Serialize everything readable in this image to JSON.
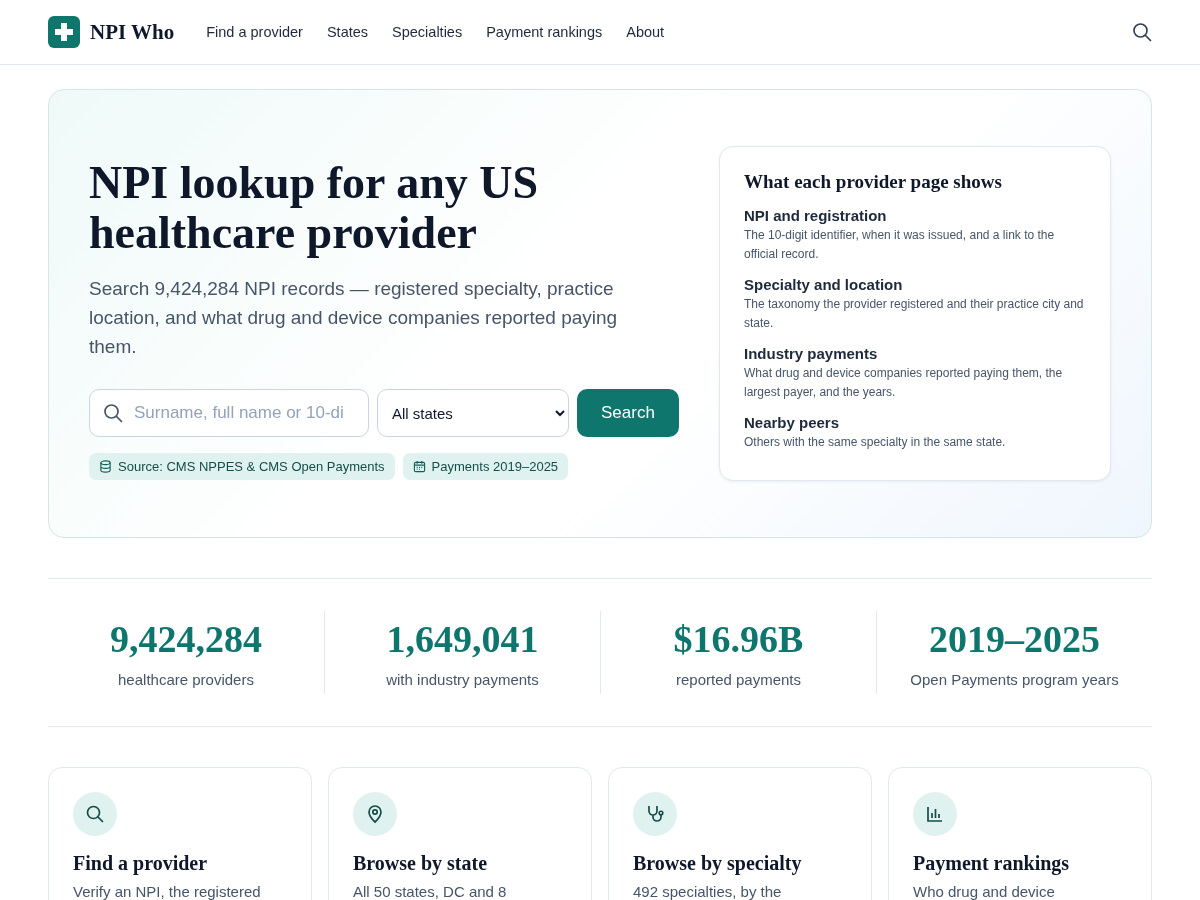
{
  "header": {
    "logo": "NPI Who",
    "nav": [
      {
        "label": "Find a provider"
      },
      {
        "label": "States"
      },
      {
        "label": "Specialties"
      },
      {
        "label": "Payment rankings"
      },
      {
        "label": "About"
      }
    ]
  },
  "hero": {
    "title": "NPI lookup for any US healthcare provider",
    "subtitle": "Search 9,424,284 NPI records — registered specialty, practice location, and what drug and device companies reported paying them.",
    "search": {
      "placeholder": "Surname, full name or 10-di",
      "state": "All states",
      "button": "Search"
    },
    "tags": [
      {
        "kind": "database",
        "label": "Source: CMS NPPES & CMS Open Payments"
      },
      {
        "kind": "calendar",
        "label": "Payments 2019–2025"
      }
    ],
    "info_card": {
      "title": "What each provider page shows",
      "items": [
        {
          "heading": "NPI and registration",
          "text": "The 10-digit identifier, when it was issued, and a link to the official record."
        },
        {
          "heading": "Specialty and location",
          "text": "The taxonomy the provider registered and their practice city and state."
        },
        {
          "heading": "Industry payments",
          "text": "What drug and device companies reported paying them, the largest payer, and the years."
        },
        {
          "heading": "Nearby peers",
          "text": "Others with the same specialty in the same state."
        }
      ]
    }
  },
  "stats": [
    {
      "value": "9,424,284",
      "label": "healthcare providers"
    },
    {
      "value": "1,649,041",
      "label": "with industry payments"
    },
    {
      "value": "$16.96B",
      "label": "reported payments"
    },
    {
      "value": "2019–2025",
      "label": "Open Payments program years"
    }
  ],
  "cards": [
    {
      "kind": "search",
      "title": "Find a provider",
      "text": "Verify an NPI, the registered"
    },
    {
      "kind": "pin",
      "title": "Browse by state",
      "text": "All 50 states, DC and 8"
    },
    {
      "kind": "stethoscope",
      "title": "Browse by specialty",
      "text": "492 specialties, by the"
    },
    {
      "kind": "chart",
      "title": "Payment rankings",
      "text": "Who drug and device"
    }
  ]
}
